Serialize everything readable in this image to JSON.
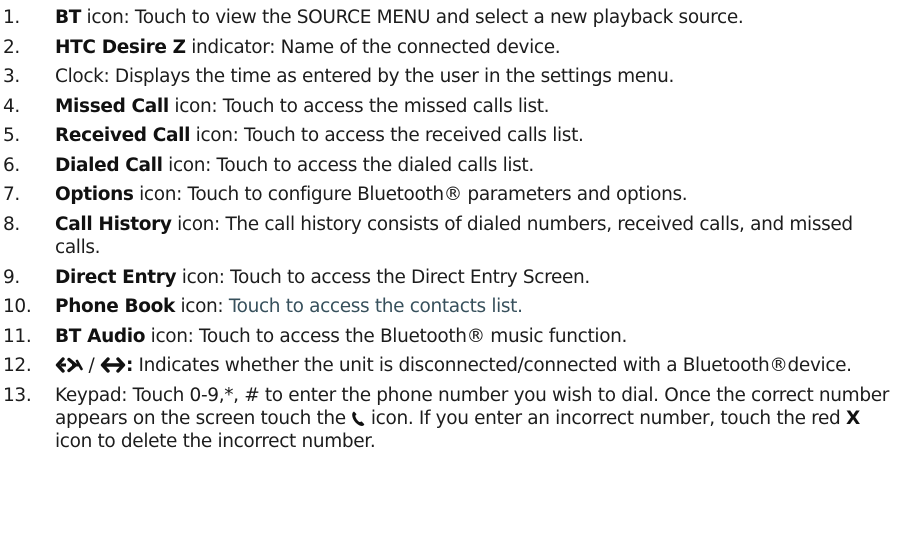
{
  "items": [
    {
      "num": "1.",
      "bold": "BT",
      "rest": " icon: Touch to view the SOURCE MENU and select a new playback source."
    },
    {
      "num": "2.",
      "bold": "HTC Desire Z",
      "rest": " indicator: Name of the connected device."
    },
    {
      "num": "3.",
      "bold": "",
      "rest": "Clock: Displays the time as entered by the user in the settings menu."
    },
    {
      "num": "4.",
      "bold": "Missed Call",
      "rest": " icon: Touch to access the missed calls list."
    },
    {
      "num": "5.",
      "bold": "Received Call",
      "rest": " icon: Touch to access the received calls list."
    },
    {
      "num": "6.",
      "bold": "Dialed Call",
      "rest": " icon: Touch to access the dialed calls list."
    },
    {
      "num": "7.",
      "bold": "Options",
      "rest": " icon: Touch to configure Bluetooth® parameters and options."
    },
    {
      "num": "8.",
      "bold": "Call History",
      "rest": " icon: The call history consists of dialed numbers, received calls, and missed calls."
    },
    {
      "num": "9.",
      "bold": "Direct Entry",
      "rest": " icon: Touch to access the Direct Entry Screen."
    },
    {
      "num": "10.",
      "bold": "Phone Book",
      "rest_plain": " icon: ",
      "rest_muted": "Touch to access the contacts list."
    },
    {
      "num": "11.",
      "bold": "BT Audio",
      "rest": " icon: Touch to access the Bluetooth® music function."
    },
    {
      "num": "12.",
      "sep": " / ",
      "colon": ":",
      "rest": " Indicates whether the unit is disconnected/connected with a Bluetooth®device."
    },
    {
      "num": "13.",
      "part1": "Keypad: Touch 0-9,*, # to enter the phone number you wish to dial. Once the correct number appears on the screen touch the ",
      "part2": " icon. If you enter an incorrect number, touch the red ",
      "x": "X",
      "part3": " icon to delete the incorrect number."
    }
  ],
  "icons": {
    "disconnected": "bluetooth-disconnected-icon",
    "connected": "bluetooth-connected-icon",
    "call": "phone-handset-icon"
  }
}
